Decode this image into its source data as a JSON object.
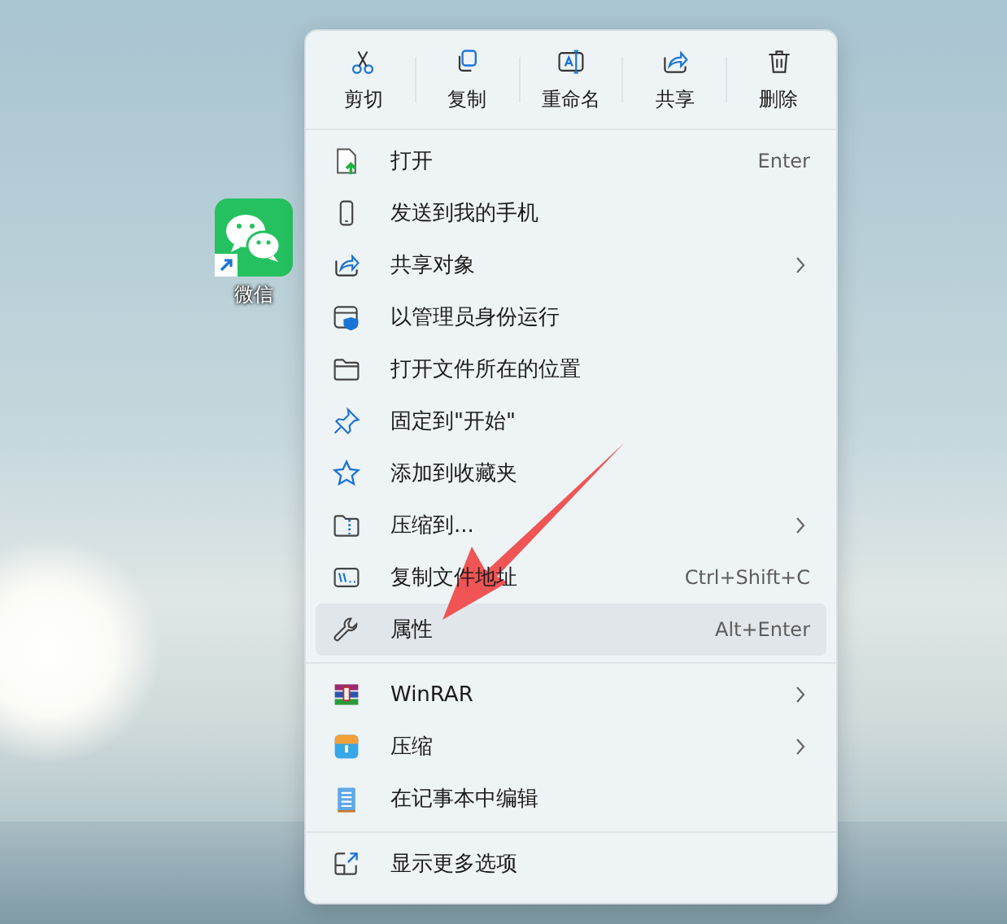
{
  "desktop_icon": {
    "label": "微信"
  },
  "toolbar": [
    {
      "label": "剪切"
    },
    {
      "label": "复制"
    },
    {
      "label": "重命名"
    },
    {
      "label": "共享"
    },
    {
      "label": "删除"
    }
  ],
  "menu_groups": [
    [
      {
        "label": "打开",
        "shortcut": "Enter",
        "submenu": false,
        "selected": false
      },
      {
        "label": "发送到我的手机",
        "submenu": false,
        "selected": false
      },
      {
        "label": "共享对象",
        "submenu": true,
        "selected": false
      },
      {
        "label": "以管理员身份运行",
        "submenu": false,
        "selected": false
      },
      {
        "label": "打开文件所在的位置",
        "submenu": false,
        "selected": false
      },
      {
        "label": "固定到\"开始\"",
        "submenu": false,
        "selected": false
      },
      {
        "label": "添加到收藏夹",
        "submenu": false,
        "selected": false
      },
      {
        "label": "压缩到...",
        "submenu": true,
        "selected": false
      },
      {
        "label": "复制文件地址",
        "shortcut": "Ctrl+Shift+C",
        "submenu": false,
        "selected": false
      },
      {
        "label": "属性",
        "shortcut": "Alt+Enter",
        "submenu": false,
        "selected": true
      }
    ],
    [
      {
        "label": "WinRAR",
        "submenu": true,
        "selected": false
      },
      {
        "label": "压缩",
        "submenu": true,
        "selected": false
      },
      {
        "label": "在记事本中编辑",
        "submenu": false,
        "selected": false
      }
    ],
    [
      {
        "label": "显示更多选项",
        "submenu": false,
        "selected": false
      }
    ]
  ]
}
